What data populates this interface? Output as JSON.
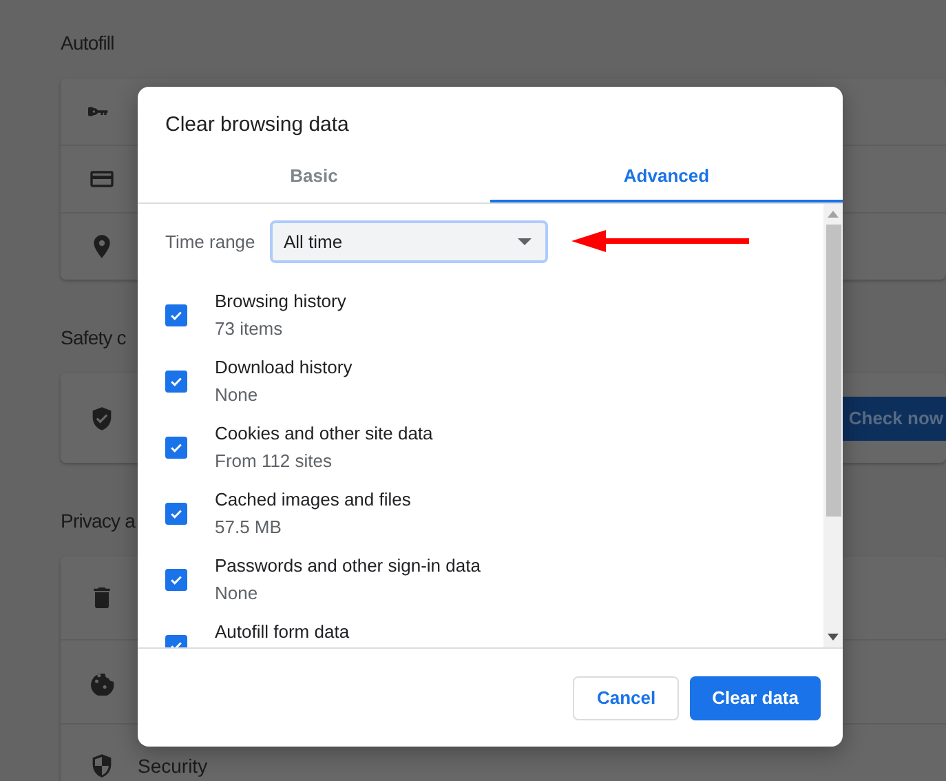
{
  "settings_page": {
    "sections": [
      {
        "heading": "Autofill"
      },
      {
        "heading": "Safety c",
        "button": "Check now"
      },
      {
        "heading": "Privacy a",
        "row_label": "Security"
      }
    ]
  },
  "dialog": {
    "title": "Clear browsing data",
    "tabs": [
      {
        "label": "Basic",
        "selected": false
      },
      {
        "label": "Advanced",
        "selected": true
      }
    ],
    "time_range": {
      "label": "Time range",
      "value": "All time"
    },
    "items": [
      {
        "label": "Browsing history",
        "detail": "73 items",
        "checked": true
      },
      {
        "label": "Download history",
        "detail": "None",
        "checked": true
      },
      {
        "label": "Cookies and other site data",
        "detail": "From 112 sites",
        "checked": true
      },
      {
        "label": "Cached images and files",
        "detail": "57.5 MB",
        "checked": true
      },
      {
        "label": "Passwords and other sign-in data",
        "detail": "None",
        "checked": true
      },
      {
        "label": "Autofill form data",
        "checked": true
      }
    ],
    "buttons": {
      "cancel": "Cancel",
      "confirm": "Clear data"
    }
  }
}
